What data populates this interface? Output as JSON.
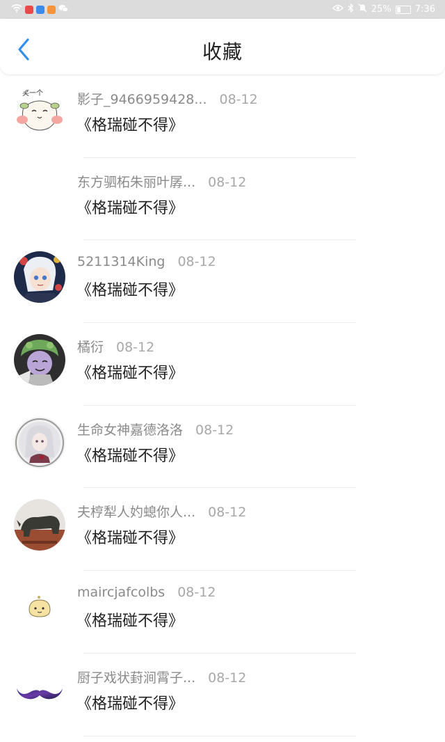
{
  "status_bar": {
    "battery": "25%",
    "time": "7:36"
  },
  "header": {
    "title": "收藏"
  },
  "items": [
    {
      "username": "影子_9466959428...",
      "date": "08-12",
      "title": "《格瑞碰不得》",
      "avatar_caption": "笑一个"
    },
    {
      "username": "东方驷柘朱丽叶孱...",
      "date": "08-12",
      "title": "《格瑞碰不得》"
    },
    {
      "username": "5211314King",
      "date": "08-12",
      "title": "《格瑞碰不得》"
    },
    {
      "username": "橘衍",
      "date": "08-12",
      "title": "《格瑞碰不得》"
    },
    {
      "username": "生命女神嘉德洛洛",
      "date": "08-12",
      "title": "《格瑞碰不得》"
    },
    {
      "username": "夫梈犁人妁螅你人...",
      "date": "08-12",
      "title": "《格瑞碰不得》"
    },
    {
      "username": "maircjafcolbs",
      "date": "08-12",
      "title": "《格瑞碰不得》"
    },
    {
      "username": "厨子戏状葑涧霄子...",
      "date": "08-12",
      "title": "《格瑞碰不得》"
    }
  ]
}
